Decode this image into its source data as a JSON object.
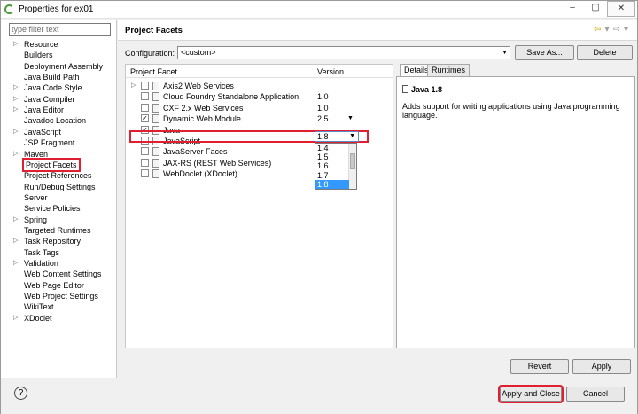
{
  "window": {
    "title": "Properties for ex01",
    "minimize": "‒",
    "maximize": "▢",
    "close": "✕"
  },
  "sidebar": {
    "filter_placeholder": "type filter text",
    "items": [
      {
        "label": "Resource",
        "expandable": true
      },
      {
        "label": "Builders",
        "expandable": false
      },
      {
        "label": "Deployment Assembly",
        "expandable": false
      },
      {
        "label": "Java Build Path",
        "expandable": false
      },
      {
        "label": "Java Code Style",
        "expandable": true
      },
      {
        "label": "Java Compiler",
        "expandable": true
      },
      {
        "label": "Java Editor",
        "expandable": true
      },
      {
        "label": "Javadoc Location",
        "expandable": false
      },
      {
        "label": "JavaScript",
        "expandable": true
      },
      {
        "label": "JSP Fragment",
        "expandable": false
      },
      {
        "label": "Maven",
        "expandable": true
      },
      {
        "label": "Project Facets",
        "expandable": false,
        "selected": true
      },
      {
        "label": "Project References",
        "expandable": false
      },
      {
        "label": "Run/Debug Settings",
        "expandable": false
      },
      {
        "label": "Server",
        "expandable": false
      },
      {
        "label": "Service Policies",
        "expandable": false
      },
      {
        "label": "Spring",
        "expandable": true
      },
      {
        "label": "Targeted Runtimes",
        "expandable": false
      },
      {
        "label": "Task Repository",
        "expandable": true
      },
      {
        "label": "Task Tags",
        "expandable": false
      },
      {
        "label": "Validation",
        "expandable": true
      },
      {
        "label": "Web Content Settings",
        "expandable": false
      },
      {
        "label": "Web Page Editor",
        "expandable": false
      },
      {
        "label": "Web Project Settings",
        "expandable": false
      },
      {
        "label": "WikiText",
        "expandable": false
      },
      {
        "label": "XDoclet",
        "expandable": true
      }
    ]
  },
  "page": {
    "title": "Project Facets",
    "config_label": "Configuration:",
    "config_value": "<custom>",
    "save_as": "Save As...",
    "delete": "Delete"
  },
  "facets": {
    "col_facet": "Project Facet",
    "col_version": "Version",
    "rows": [
      {
        "name": "Axis2 Web Services",
        "version": "",
        "checked": false,
        "expandable": true
      },
      {
        "name": "Cloud Foundry Standalone Application",
        "version": "1.0",
        "checked": false
      },
      {
        "name": "CXF 2.x Web Services",
        "version": "1.0",
        "checked": false
      },
      {
        "name": "Dynamic Web Module",
        "version": "2.5",
        "checked": true,
        "has_dropdown": true
      },
      {
        "name": "Java",
        "version": "1.8",
        "checked": true,
        "has_dropdown": true
      },
      {
        "name": "JavaScript",
        "version": "",
        "checked": false
      },
      {
        "name": "JavaServer Faces",
        "version": "",
        "checked": false
      },
      {
        "name": "JAX-RS (REST Web Services)",
        "version": "",
        "checked": false
      },
      {
        "name": "WebDoclet (XDoclet)",
        "version": "",
        "checked": false
      }
    ],
    "checkmark": "✓",
    "version_dropdown_value": "1.8",
    "version_options": [
      "1.4",
      "1.5",
      "1.6",
      "1.7",
      "1.8"
    ],
    "version_selected": "1.8"
  },
  "details": {
    "tab_details": "Details",
    "tab_runtimes": "Runtimes",
    "java_title": "Java 1.8",
    "description": "Adds support for writing applications using Java programming language."
  },
  "actions": {
    "revert": "Revert",
    "apply": "Apply",
    "apply_and_close": "Apply and Close",
    "cancel": "Cancel",
    "help": "?"
  },
  "colors": {
    "highlight_red": "#e02030",
    "selection_blue": "#3399ff"
  }
}
